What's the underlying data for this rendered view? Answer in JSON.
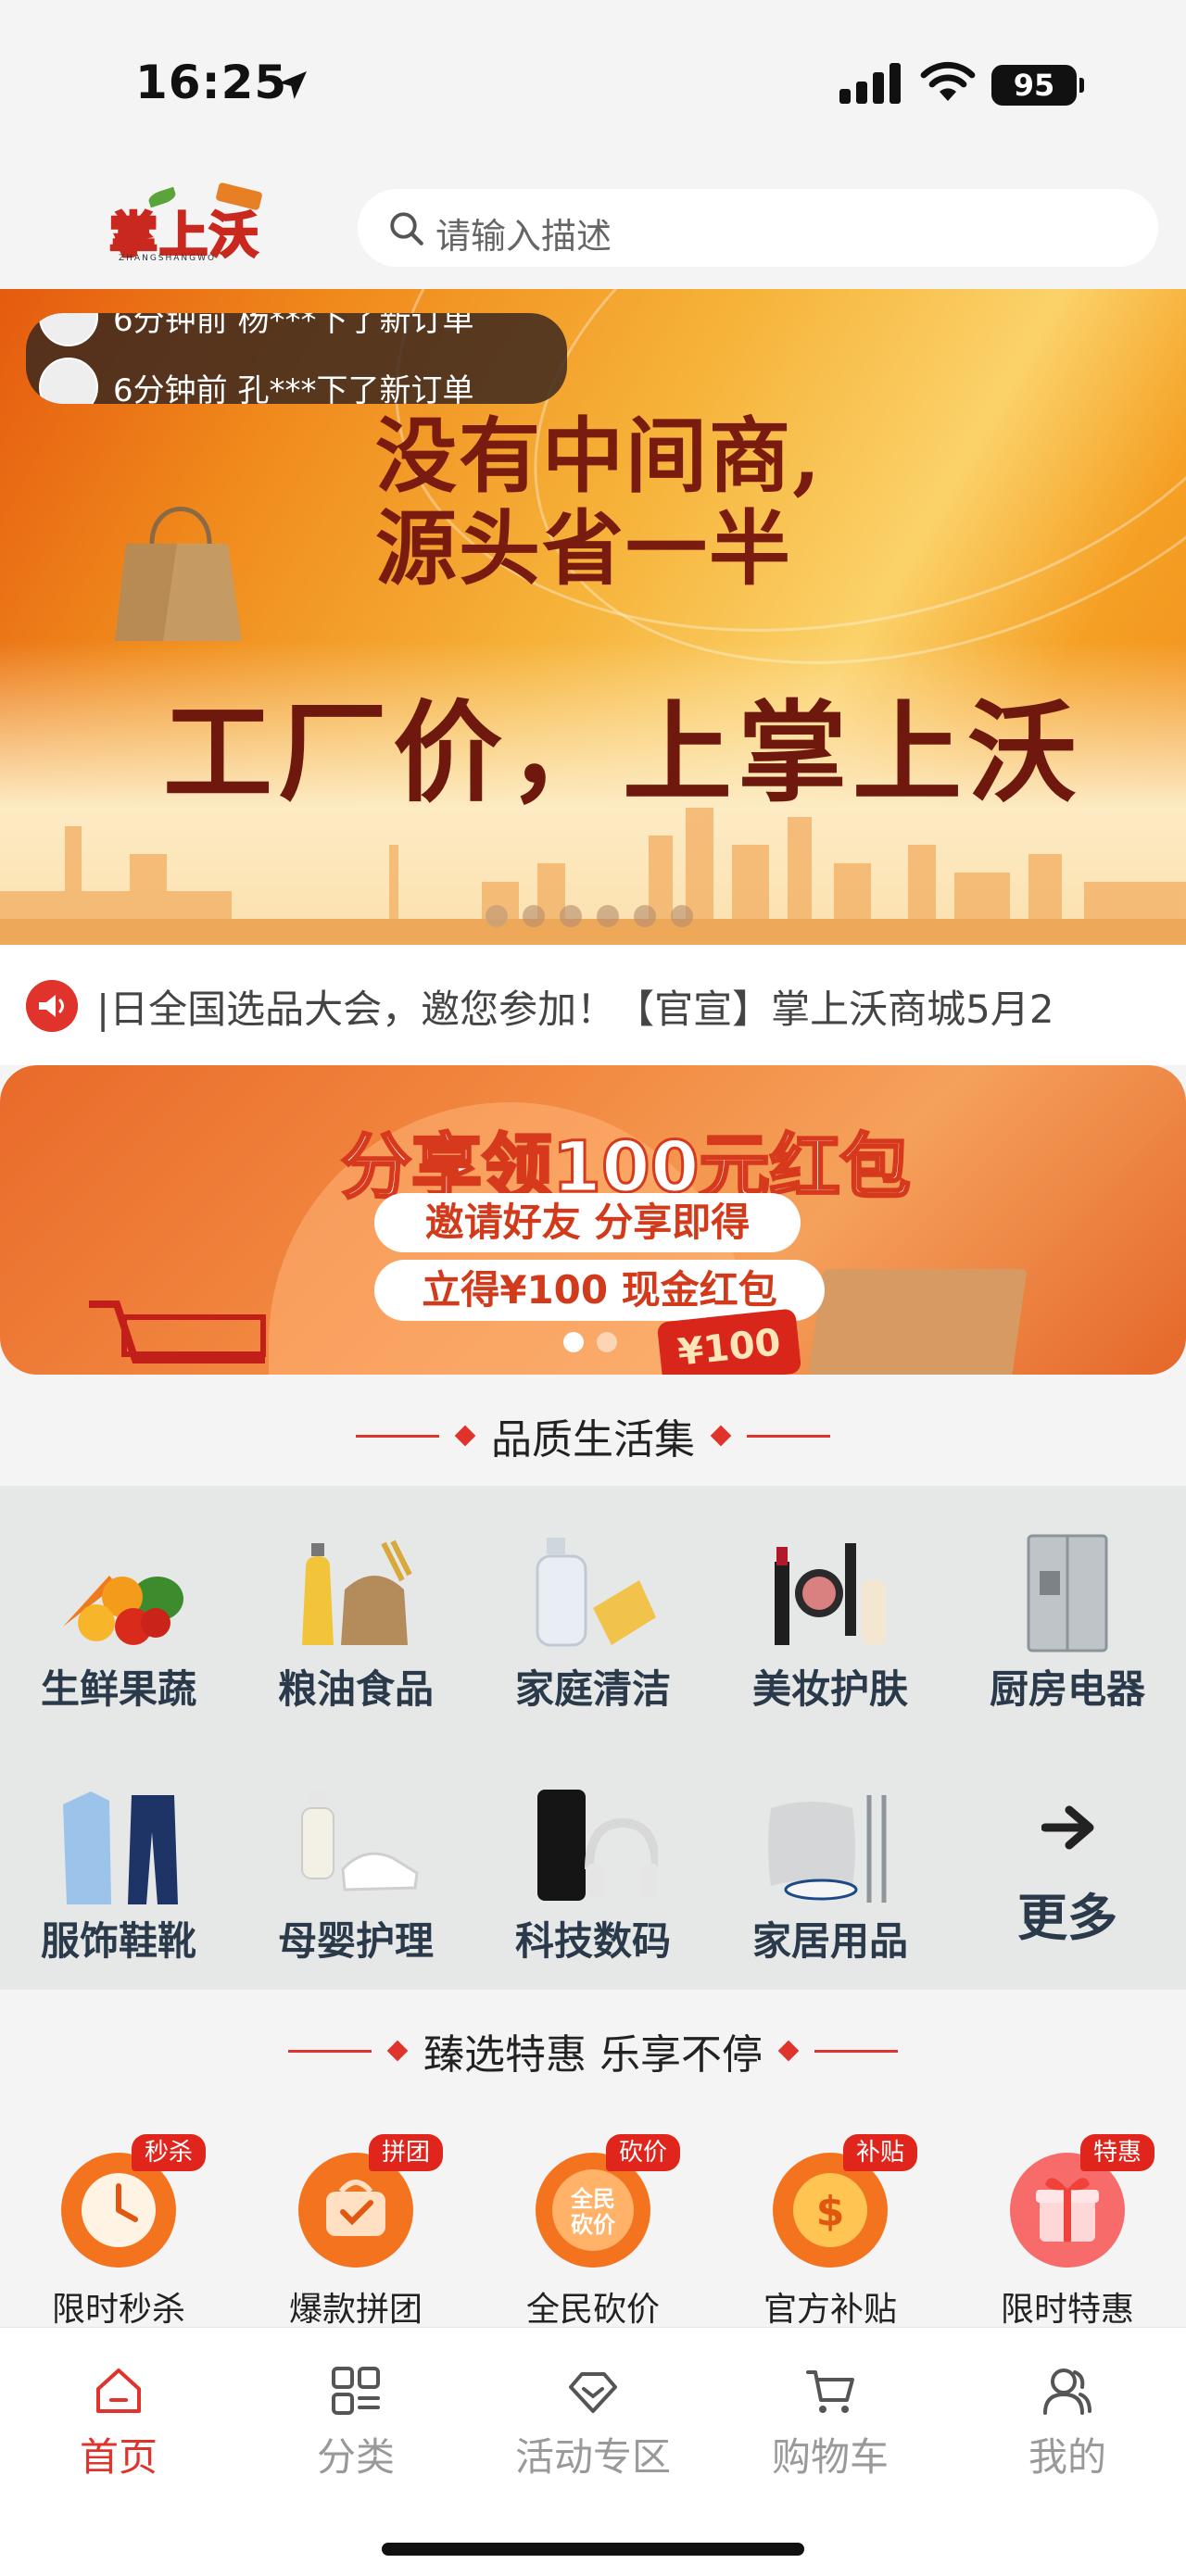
{
  "status_bar": {
    "time": "16:25",
    "battery": "95"
  },
  "header": {
    "logo_text": "掌上沃",
    "logo_sub": "ZHANGSHANGWO",
    "search_placeholder": "请输入描述"
  },
  "banner": {
    "feed": [
      {
        "text": "6分钟前 杨***下了新订单"
      },
      {
        "text": "6分钟前 孔***下了新订单"
      }
    ],
    "line1": "没有中间商,",
    "line2": "源头省一半",
    "main": "工厂价，上掌上沃",
    "dots": 6,
    "active_dot": 0
  },
  "notice": {
    "text": "|日全国选品大会，邀您参加！【官宣】掌上沃商城5月2"
  },
  "promo": {
    "title": "分享领100元红包",
    "line1": "邀请好友  分享即得",
    "line2": "立得¥100 现金红包",
    "coupon": "¥100"
  },
  "section_quality": {
    "title": "品质生活集"
  },
  "categories": [
    {
      "label": "生鲜果蔬",
      "icon": "vegetables-icon"
    },
    {
      "label": "粮油食品",
      "icon": "grain-oil-icon"
    },
    {
      "label": "家庭清洁",
      "icon": "cleaning-icon"
    },
    {
      "label": "美妆护肤",
      "icon": "cosmetics-icon"
    },
    {
      "label": "厨房电器",
      "icon": "fridge-icon"
    },
    {
      "label": "服饰鞋靴",
      "icon": "clothing-icon"
    },
    {
      "label": "母婴护理",
      "icon": "baby-icon"
    },
    {
      "label": "科技数码",
      "icon": "phone-headphones-icon"
    },
    {
      "label": "家居用品",
      "icon": "home-goods-icon"
    },
    {
      "label": "更多",
      "icon": "arrow-right-icon"
    }
  ],
  "section_deals": {
    "title": "臻选特惠 乐享不停"
  },
  "deals": [
    {
      "label": "限时秒杀",
      "tag": "秒杀",
      "icon": "clock-icon",
      "color": "#f4731f"
    },
    {
      "label": "爆款拼团",
      "tag": "拼团",
      "icon": "group-bag-icon",
      "color": "#f4731f"
    },
    {
      "label": "全民砍价",
      "tag": "砍价",
      "icon": "bargain-badge-icon",
      "color": "#f4731f"
    },
    {
      "label": "官方补贴",
      "tag": "补贴",
      "icon": "coin-icon",
      "color": "#f4731f"
    },
    {
      "label": "限时特惠",
      "tag": "特惠",
      "icon": "gift-icon",
      "color": "#f76b6b"
    }
  ],
  "tabbar": [
    {
      "label": "首页",
      "icon": "home-icon",
      "active": true
    },
    {
      "label": "分类",
      "icon": "category-icon",
      "active": false
    },
    {
      "label": "活动专区",
      "icon": "diamond-icon",
      "active": false
    },
    {
      "label": "购物车",
      "icon": "cart-icon",
      "active": false
    },
    {
      "label": "我的",
      "icon": "profile-icon",
      "active": false
    }
  ],
  "colors": {
    "accent": "#e0332b",
    "tab_inactive": "#999999",
    "banner_text": "#7a1b10"
  }
}
